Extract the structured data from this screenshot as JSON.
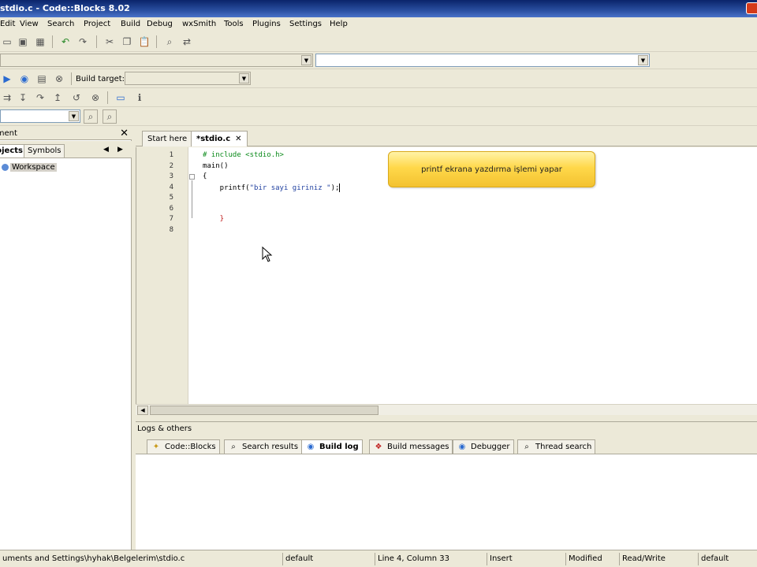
{
  "window": {
    "title": "stdio.c - Code::Blocks 8.02"
  },
  "menu": [
    "Edit",
    "View",
    "Search",
    "Project",
    "Build",
    "Debug",
    "wxSmith",
    "Tools",
    "Plugins",
    "Settings",
    "Help"
  ],
  "toolbar": {
    "build_target_label": "Build target:",
    "build_target_value": ""
  },
  "management": {
    "title": "Management",
    "tabs": [
      "Projects",
      "Symbols"
    ],
    "workspace_label": "Workspace"
  },
  "editor": {
    "tabs": [
      {
        "label": "Start here",
        "active": false
      },
      {
        "label": "*stdio.c",
        "active": true,
        "close": "✕"
      }
    ],
    "line_numbers": [
      "1",
      "2",
      "3",
      "4",
      "5",
      "6",
      "7",
      "8"
    ],
    "lines": {
      "l1": "# include <stdio.h>",
      "l2": "main()",
      "l3": "{",
      "l4_fn": "    printf(",
      "l4_str": "\"bir sayi giriniz \"",
      "l4_end": ");",
      "l7": "    }"
    }
  },
  "tooltip": {
    "text": "printf ekrana yazdırma işlemi yapar"
  },
  "logs": {
    "title": "Logs & others",
    "tabs": [
      {
        "label": "Code::Blocks",
        "icon": "codeblocks-icon",
        "active": false
      },
      {
        "label": "Search results",
        "icon": "search-icon",
        "active": false
      },
      {
        "label": "Build log",
        "icon": "build-log-icon",
        "active": true
      },
      {
        "label": "Build messages",
        "icon": "build-messages-icon",
        "active": false
      },
      {
        "label": "Debugger",
        "icon": "debugger-icon",
        "active": false
      },
      {
        "label": "Thread search",
        "icon": "thread-search-icon",
        "active": false
      }
    ]
  },
  "status": {
    "path": "uments and Settings\\hyhak\\Belgelerim\\stdio.c",
    "encoding": "default",
    "position": "Line 4, Column 33",
    "mode": "Insert",
    "modified": "Modified",
    "access": "Read/Write",
    "profile": "default"
  },
  "colors": {
    "title_bar": "#0a246a",
    "tooltip_bg": "#ffd84a",
    "comment_green": "#0a8a1a"
  }
}
